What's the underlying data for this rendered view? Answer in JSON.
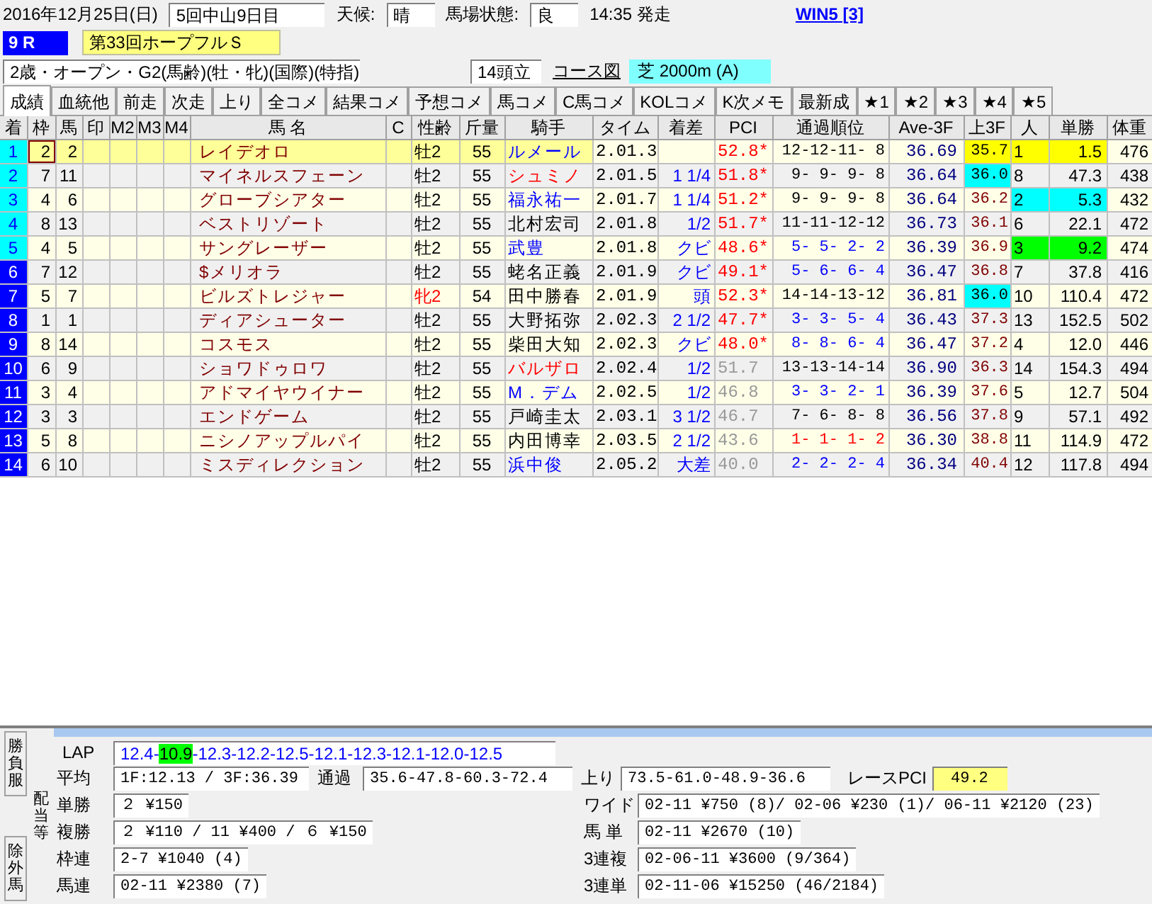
{
  "race_header": {
    "date": "2016年12月25日(日)",
    "meeting": "5回中山9日目",
    "weather_label": "天候:",
    "weather": "晴",
    "going_label": "馬場状態:",
    "going": "良",
    "post_time": "14:35 発走",
    "win5_link": "WIN5 [3]"
  },
  "race": {
    "number": "9 R",
    "name": "第33回ホープフルＳ",
    "conditions": "2歳・オープン・G2(馬齢)(牡・牝)(国際)(特指)",
    "runners": "14頭立",
    "course_map_link": "コース図",
    "course": "芝 2000m (A)"
  },
  "tabs": [
    {
      "label": "成績",
      "selected": true
    },
    {
      "label": "血統他",
      "selected": false
    },
    {
      "label": "前走",
      "selected": false
    },
    {
      "label": "次走",
      "selected": false
    },
    {
      "label": "上り",
      "selected": false
    },
    {
      "label": "全コメ",
      "selected": false
    },
    {
      "label": "結果コメ",
      "selected": false
    },
    {
      "label": "予想コメ",
      "selected": false
    },
    {
      "label": "馬コメ",
      "selected": false
    },
    {
      "label": "C馬コメ",
      "selected": false
    },
    {
      "label": "KOLコメ",
      "selected": false
    },
    {
      "label": "K次メモ",
      "selected": false
    },
    {
      "label": "最新成",
      "selected": false
    },
    {
      "label": "★1",
      "selected": false
    },
    {
      "label": "★2",
      "selected": false
    },
    {
      "label": "★3",
      "selected": false
    },
    {
      "label": "★4",
      "selected": false
    },
    {
      "label": "★5",
      "selected": false
    }
  ],
  "table": {
    "columns": [
      "着",
      "枠",
      "馬",
      "印",
      "M2",
      "M3",
      "M4",
      "馬 名",
      "C",
      "性齢",
      "斤量",
      "騎手",
      "タイム",
      "着差",
      "PCI",
      "通過順位",
      "Ave-3F",
      "上3F",
      "人",
      "単勝",
      "体重"
    ],
    "rows": [
      {
        "selected": true,
        "rank": {
          "text": "1",
          "color": "#00ffff"
        },
        "frame": "2",
        "number": "2",
        "name": "レイデオロ",
        "sex_age": {
          "text": "牡2",
          "color": "#000000"
        },
        "weight": "55",
        "jockey": {
          "text": "ルメール",
          "color": "#0000ff"
        },
        "time": "2.01.3",
        "pci": {
          "text": "52.8*",
          "color": "#ff0000"
        },
        "passing": {
          "text": "12-12-11- 8",
          "color": "#000000"
        },
        "ave_3f": "36.69",
        "last_3f": {
          "text": "35.7",
          "color": "#000000",
          "marker": {
            "color": "#ffff00"
          }
        },
        "popularity": {
          "text": "1",
          "color": "#ffff00"
        },
        "odds": {
          "text": "1.5",
          "color": "#ffff00"
        },
        "body_weight": "476"
      },
      {
        "selected": false,
        "rank": {
          "text": "2",
          "color": "#00ffff"
        },
        "frame": "7",
        "number": "11",
        "name": "マイネルスフェーン",
        "sex_age": {
          "text": "牡2",
          "color": "#000000"
        },
        "weight": "55",
        "jockey": {
          "text": "シュミノ",
          "color": "#ff0000"
        },
        "time": "2.01.5",
        "margin": "1 1/4",
        "pci": {
          "text": "51.8*",
          "color": "#ff0000"
        },
        "passing": {
          "text": "9- 9- 9- 8",
          "color": "#000000"
        },
        "ave_3f": "36.64",
        "last_3f": {
          "text": "36.0",
          "color": "#000000",
          "marker": {
            "color": "#00ffff"
          }
        },
        "popularity": {
          "text": "8"
        },
        "odds": {
          "text": "47.3"
        },
        "body_weight": "438"
      },
      {
        "selected": false,
        "rank": {
          "text": "3",
          "color": "#00ffff"
        },
        "frame": "4",
        "number": "6",
        "name": "グローブシアター",
        "sex_age": {
          "text": "牡2",
          "color": "#000000"
        },
        "weight": "55",
        "jockey": {
          "text": "福永祐一",
          "color": "#0000ff"
        },
        "time": "2.01.7",
        "margin": "1 1/4",
        "pci": {
          "text": "51.2*",
          "color": "#ff0000"
        },
        "passing": {
          "text": "9- 9- 9- 8",
          "color": "#000000"
        },
        "ave_3f": "36.64",
        "last_3f": {
          "text": "36.2",
          "color": "#800000"
        },
        "popularity": {
          "text": "2",
          "color": "#00ffff"
        },
        "odds": {
          "text": "5.3",
          "color": "#00ffff"
        },
        "body_weight": "432"
      },
      {
        "selected": false,
        "rank": {
          "text": "4",
          "color": "#00ffff"
        },
        "frame": "8",
        "number": "13",
        "name": "ベストリゾート",
        "sex_age": {
          "text": "牡2",
          "color": "#000000"
        },
        "weight": "55",
        "jockey": {
          "text": "北村宏司",
          "color": "#000000"
        },
        "time": "2.01.8",
        "margin": "1/2",
        "pci": {
          "text": "51.7*",
          "color": "#ff0000"
        },
        "passing": {
          "text": "11-11-12-12",
          "color": "#000000"
        },
        "ave_3f": "36.73",
        "last_3f": {
          "text": "36.1",
          "color": "#800000"
        },
        "popularity": {
          "text": "6"
        },
        "odds": {
          "text": "22.1"
        },
        "body_weight": "472"
      },
      {
        "selected": false,
        "rank": {
          "text": "5",
          "color": "#00ffff"
        },
        "frame": "4",
        "number": "5",
        "name": "サングレーザー",
        "sex_age": {
          "text": "牡2",
          "color": "#000000"
        },
        "weight": "55",
        "jockey": {
          "text": "武豊",
          "color": "#0000ff"
        },
        "time": "2.01.8",
        "margin": "クビ",
        "pci": {
          "text": "48.6*",
          "color": "#ff0000"
        },
        "passing": {
          "text": "5- 5- 2- 2",
          "color": "#0000ff"
        },
        "ave_3f": "36.39",
        "last_3f": {
          "text": "36.9",
          "color": "#800000"
        },
        "popularity": {
          "text": "3",
          "color": "#00ff00"
        },
        "odds": {
          "text": "9.2",
          "color": "#00ff00"
        },
        "body_weight": "474"
      },
      {
        "selected": false,
        "rank": {
          "text": "6",
          "color": "#0000ff"
        },
        "frame": "7",
        "number": "12",
        "name": "$メリオラ",
        "sex_age": {
          "text": "牡2",
          "color": "#000000"
        },
        "weight": "55",
        "jockey": {
          "text": "蛯名正義",
          "color": "#000000"
        },
        "time": "2.01.9",
        "margin": "クビ",
        "pci": {
          "text": "49.1*",
          "color": "#ff0000"
        },
        "passing": {
          "text": "5- 6- 6- 4",
          "color": "#0000ff"
        },
        "ave_3f": "36.47",
        "last_3f": {
          "text": "36.8",
          "color": "#800000"
        },
        "popularity": {
          "text": "7"
        },
        "odds": {
          "text": "37.8"
        },
        "body_weight": "416"
      },
      {
        "selected": false,
        "rank": {
          "text": "7",
          "color": "#0000ff"
        },
        "frame": "5",
        "number": "7",
        "name": "ビルズトレジャー",
        "sex_age": {
          "text": "牝2",
          "color": "#ff0000"
        },
        "weight": "54",
        "jockey": {
          "text": "田中勝春",
          "color": "#000000"
        },
        "time": "2.01.9",
        "margin": "頭",
        "pci": {
          "text": "52.3*",
          "color": "#ff0000"
        },
        "passing": {
          "text": "14-14-13-12",
          "color": "#000000"
        },
        "ave_3f": "36.81",
        "last_3f": {
          "text": "36.0",
          "color": "#000000",
          "marker": {
            "color": "#00ffff"
          }
        },
        "popularity": {
          "text": "10"
        },
        "odds": {
          "text": "110.4"
        },
        "body_weight": "472"
      },
      {
        "selected": false,
        "rank": {
          "text": "8",
          "color": "#0000ff"
        },
        "frame": "1",
        "number": "1",
        "name": "ディアシューター",
        "sex_age": {
          "text": "牡2",
          "color": "#000000"
        },
        "weight": "55",
        "jockey": {
          "text": "大野拓弥",
          "color": "#000000"
        },
        "time": "2.02.3",
        "margin": "2 1/2",
        "pci": {
          "text": "47.7*",
          "color": "#ff0000"
        },
        "passing": {
          "text": "3- 3- 5- 4",
          "color": "#0000ff"
        },
        "ave_3f": "36.43",
        "last_3f": {
          "text": "37.3",
          "color": "#800000"
        },
        "popularity": {
          "text": "13"
        },
        "odds": {
          "text": "152.5"
        },
        "body_weight": "502"
      },
      {
        "selected": false,
        "rank": {
          "text": "9",
          "color": "#0000ff"
        },
        "frame": "8",
        "number": "14",
        "name": "コスモス",
        "sex_age": {
          "text": "牡2",
          "color": "#000000"
        },
        "weight": "55",
        "jockey": {
          "text": "柴田大知",
          "color": "#000000"
        },
        "time": "2.02.3",
        "margin": "クビ",
        "pci": {
          "text": "48.0*",
          "color": "#ff0000"
        },
        "passing": {
          "text": "8- 8- 6- 4",
          "color": "#0000ff"
        },
        "ave_3f": "36.47",
        "last_3f": {
          "text": "37.2",
          "color": "#800000"
        },
        "popularity": {
          "text": "4"
        },
        "odds": {
          "text": "12.0"
        },
        "body_weight": "446"
      },
      {
        "selected": false,
        "rank": {
          "text": "10",
          "color": "#0000ff"
        },
        "frame": "6",
        "number": "9",
        "name": "ショワドゥロワ",
        "sex_age": {
          "text": "牡2",
          "color": "#000000"
        },
        "weight": "55",
        "jockey": {
          "text": "バルザロ",
          "color": "#ff0000"
        },
        "time": "2.02.4",
        "margin": "1/2",
        "pci": {
          "text": "51.7",
          "color": "#999999"
        },
        "passing": {
          "text": "13-13-14-14",
          "color": "#000000"
        },
        "ave_3f": "36.90",
        "last_3f": {
          "text": "36.3",
          "color": "#800000"
        },
        "popularity": {
          "text": "14"
        },
        "odds": {
          "text": "154.3"
        },
        "body_weight": "494"
      },
      {
        "selected": false,
        "rank": {
          "text": "11",
          "color": "#0000ff"
        },
        "frame": "3",
        "number": "4",
        "name": "アドマイヤウイナー",
        "sex_age": {
          "text": "牡2",
          "color": "#000000"
        },
        "weight": "55",
        "jockey": {
          "text": "M．デム",
          "color": "#0000ff"
        },
        "time": "2.02.5",
        "margin": "1/2",
        "pci": {
          "text": "46.8",
          "color": "#999999"
        },
        "passing": {
          "text": "3- 3- 2- 1",
          "color": "#0000ff"
        },
        "ave_3f": "36.39",
        "last_3f": {
          "text": "37.6",
          "color": "#800000"
        },
        "popularity": {
          "text": "5"
        },
        "odds": {
          "text": "12.7"
        },
        "body_weight": "504"
      },
      {
        "selected": false,
        "rank": {
          "text": "12",
          "color": "#0000ff"
        },
        "frame": "3",
        "number": "3",
        "name": "エンドゲーム",
        "sex_age": {
          "text": "牡2",
          "color": "#000000"
        },
        "weight": "55",
        "jockey": {
          "text": "戸崎圭太",
          "color": "#000000"
        },
        "time": "2.03.1",
        "margin": "3 1/2",
        "pci": {
          "text": "46.7",
          "color": "#999999"
        },
        "passing": {
          "text": "7- 6- 8- 8",
          "color": "#000000"
        },
        "ave_3f": "36.56",
        "last_3f": {
          "text": "37.8",
          "color": "#800000"
        },
        "popularity": {
          "text": "9"
        },
        "odds": {
          "text": "57.1"
        },
        "body_weight": "492"
      },
      {
        "selected": false,
        "rank": {
          "text": "13",
          "color": "#0000ff"
        },
        "frame": "5",
        "number": "8",
        "name": "ニシノアップルパイ",
        "sex_age": {
          "text": "牡2",
          "color": "#000000"
        },
        "weight": "55",
        "jockey": {
          "text": "内田博幸",
          "color": "#000000"
        },
        "time": "2.03.5",
        "margin": "2 1/2",
        "pci": {
          "text": "43.6",
          "color": "#999999"
        },
        "passing": {
          "text": "1- 1- 1- 2",
          "color": "#ff0000"
        },
        "ave_3f": "36.30",
        "last_3f": {
          "text": "38.8",
          "color": "#800000"
        },
        "popularity": {
          "text": "11"
        },
        "odds": {
          "text": "114.9"
        },
        "body_weight": "472"
      },
      {
        "selected": false,
        "rank": {
          "text": "14",
          "color": "#0000ff"
        },
        "frame": "6",
        "number": "10",
        "name": "ミスディレクション",
        "sex_age": {
          "text": "牡2",
          "color": "#000000"
        },
        "weight": "55",
        "jockey": {
          "text": "浜中俊",
          "color": "#0000ff"
        },
        "time": "2.05.2",
        "margin": "大差",
        "pci": {
          "text": "40.0",
          "color": "#999999"
        },
        "passing": {
          "text": "2- 2- 2- 4",
          "color": "#0000ff"
        },
        "ave_3f": "36.34",
        "last_3f": {
          "text": "40.4",
          "color": "#800000"
        },
        "popularity": {
          "text": "12"
        },
        "odds": {
          "text": "117.8"
        },
        "body_weight": "494"
      }
    ]
  },
  "side_tabs": [
    {
      "label": "勝負服",
      "selected": false
    },
    {
      "label": "配当等",
      "selected": true
    },
    {
      "label": "除外馬",
      "selected": false
    }
  ],
  "lap": {
    "label": "LAP",
    "separator": "-",
    "splits": [
      {
        "value": "12.4",
        "fastest": false
      },
      {
        "value": "10.9",
        "fastest": true
      },
      {
        "value": "12.3",
        "fastest": false
      },
      {
        "value": "12.2",
        "fastest": false
      },
      {
        "value": "12.5",
        "fastest": false
      },
      {
        "value": "12.1",
        "fastest": false
      },
      {
        "value": "12.3",
        "fastest": false
      },
      {
        "value": "12.1",
        "fastest": false
      },
      {
        "value": "12.0",
        "fastest": false
      },
      {
        "value": "12.5",
        "fastest": false
      }
    ]
  },
  "summary": {
    "average_label": "平均",
    "average": "1F:12.13 / 3F:36.39",
    "passing_label": "通過",
    "passing": "35.6-47.8-60.3-72.4",
    "closing_label": "上り",
    "closing": "73.5-61.0-48.9-36.6",
    "race_pci_label": "レースPCI",
    "race_pci": "49.2"
  },
  "payouts_left": [
    {
      "label": "単勝",
      "value": "２ ¥150"
    },
    {
      "label": "複勝",
      "value": "２ ¥110 / 11 ¥400 / ６ ¥150"
    },
    {
      "label": "枠連",
      "value": "2-7 ¥1040 (4)"
    },
    {
      "label": "馬連",
      "value": "02-11 ¥2380 (7)"
    }
  ],
  "payouts_right": [
    {
      "label": "ワイド",
      "value": "02-11 ¥750 (8)/ 02-06 ¥230 (1)/ 06-11 ¥2120 (23)"
    },
    {
      "label": "馬 単",
      "value": "02-11 ¥2670 (10)"
    },
    {
      "label": "3連複",
      "value": "02-06-11 ¥3600 (9/364)"
    },
    {
      "label": "3連単",
      "value": "02-11-06 ¥15250 (46/2184)"
    }
  ]
}
